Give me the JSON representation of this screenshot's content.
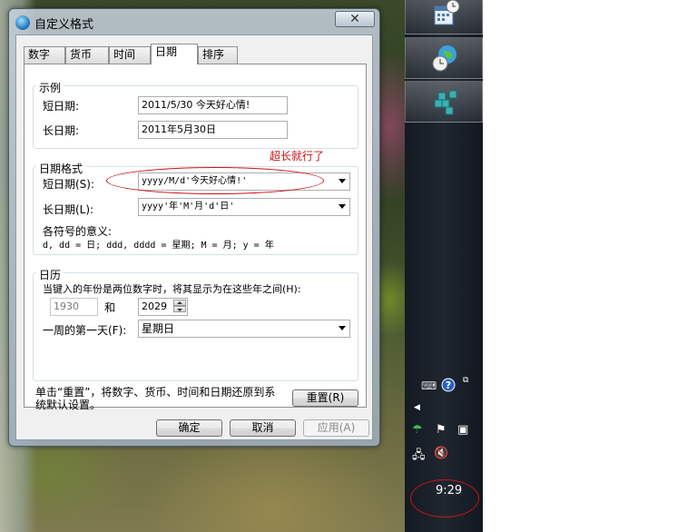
{
  "dialog": {
    "title": "自定义格式",
    "close_label": "✕",
    "tabs": [
      {
        "label": "数字"
      },
      {
        "label": "货币"
      },
      {
        "label": "时间"
      },
      {
        "label": "日期",
        "active": true
      },
      {
        "label": "排序"
      }
    ]
  },
  "example": {
    "title": "示例",
    "short_label": "短日期:",
    "short_value": "2011/5/30 今天好心情!",
    "long_label": "长日期:",
    "long_value": "2011年5月30日"
  },
  "annotation": {
    "text": "超长就行了",
    "color": "#c81414"
  },
  "date_format": {
    "title": "日期格式",
    "short_label": "短日期(S):",
    "short_value": "yyyy/M/d'今天好心情!'",
    "long_label": "长日期(L):",
    "long_value": "yyyy'年'M'月'd'日'",
    "meaning_title": "各符号的意义:",
    "meaning_text": "d, dd = 日;  ddd, dddd = 星期;  M = 月;  y = 年"
  },
  "calendar": {
    "title": "日历",
    "two_digit_label": "当键入的年份是两位数字时，将其显示为在这些年之间(H):",
    "year_from": "1930",
    "and_label": "和",
    "year_to": "2029",
    "first_day_label": "一周的第一天(F):",
    "first_day_value": "星期日"
  },
  "reset": {
    "text_line1": "单击“重置”，将数字、货币、时间和日期还原到系",
    "text_line2": "统默认设置。",
    "button": "重置(R)"
  },
  "footer": {
    "ok": "确定",
    "cancel": "取消",
    "apply": "应用(A)"
  },
  "taskbar": {
    "clock": "9:29",
    "icons": [
      "calendar-clock-icon",
      "globe-clock-icon",
      "registry-cubes-icon"
    ],
    "tray_icons": [
      "keyboard-icon",
      "help-icon",
      "restore-icon",
      "expand-arrow-icon",
      "umbrella-icon",
      "flag-icon",
      "device-icon",
      "network-icon",
      "speaker-muted-icon"
    ]
  }
}
